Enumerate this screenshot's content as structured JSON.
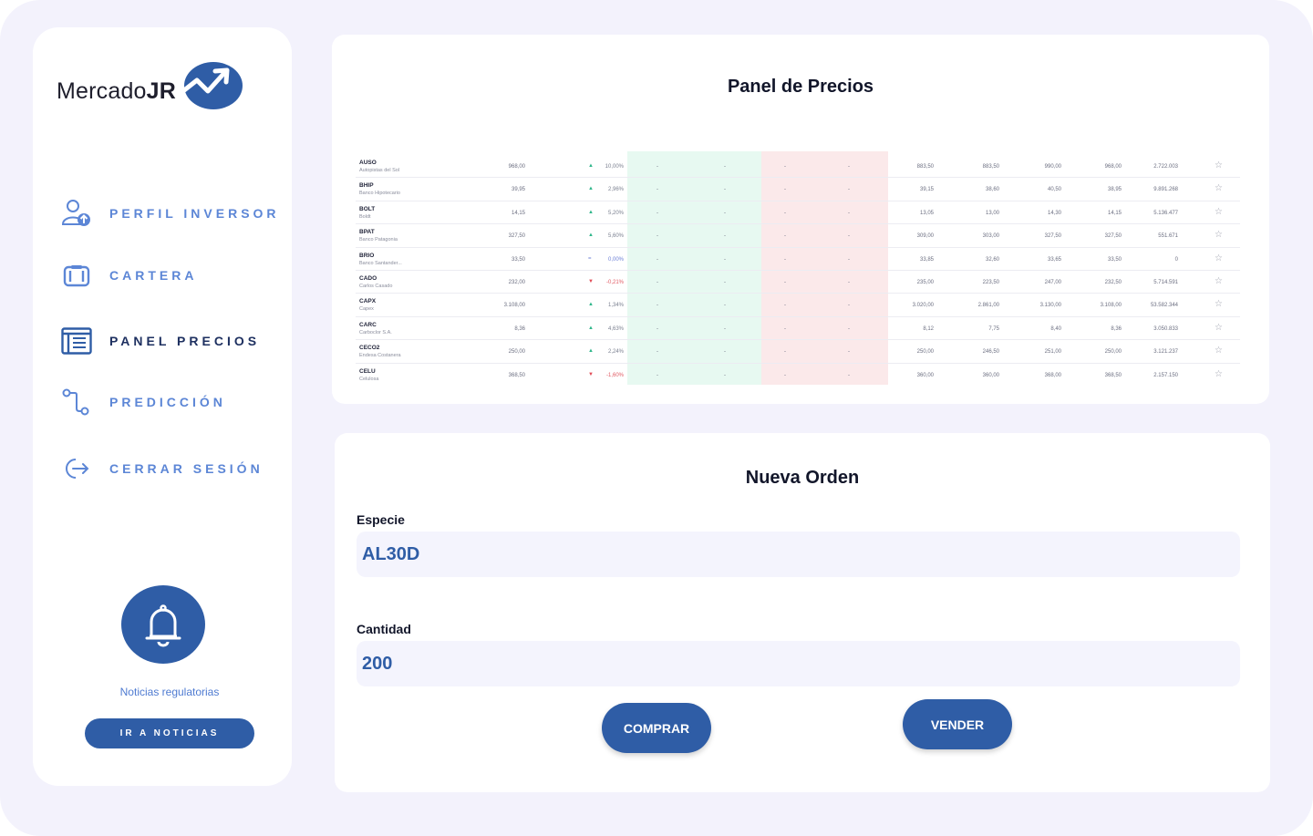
{
  "sidebar": {
    "logo": {
      "text_regular": "Mercado",
      "text_bold": "JR"
    },
    "nav": [
      {
        "label": "PERFIL INVERSOR",
        "icon": "user-upload-icon"
      },
      {
        "label": "CARTERA",
        "icon": "camera-icon"
      },
      {
        "label": "PANEL PRECIOS",
        "icon": "list-panel-icon"
      },
      {
        "label": "PREDICCIÓN",
        "icon": "path-nodes-icon"
      },
      {
        "label": "CERRAR SESIÓN",
        "icon": "logout-icon"
      }
    ],
    "active_nav": "PANEL PRECIOS",
    "news": {
      "label": "Noticias regulatorias",
      "button": "IR A NOTICIAS",
      "icon": "bell-icon"
    }
  },
  "prices_panel": {
    "title": "Panel de Precios",
    "rows": [
      {
        "symbol": "AUSO",
        "name": "Autopistas del Sol",
        "last": "968,00",
        "trend": "up",
        "pct": "10,00%",
        "c1": "883,50",
        "c2": "883,50",
        "c3": "990,00",
        "c4": "968,00",
        "volume": "2.722.003"
      },
      {
        "symbol": "BHIP",
        "name": "Banco Hipotecario",
        "last": "39,95",
        "trend": "up",
        "pct": "2,96%",
        "c1": "39,15",
        "c2": "38,60",
        "c3": "40,50",
        "c4": "38,95",
        "volume": "9.891.268"
      },
      {
        "symbol": "BOLT",
        "name": "Boldt",
        "last": "14,15",
        "trend": "up",
        "pct": "5,20%",
        "c1": "13,05",
        "c2": "13,00",
        "c3": "14,30",
        "c4": "14,15",
        "volume": "5.136.477"
      },
      {
        "symbol": "BPAT",
        "name": "Banco Patagonia",
        "last": "327,50",
        "trend": "up",
        "pct": "5,60%",
        "c1": "309,00",
        "c2": "303,00",
        "c3": "327,50",
        "c4": "327,50",
        "volume": "551.671"
      },
      {
        "symbol": "BRIO",
        "name": "Banco Santander...",
        "last": "33,50",
        "trend": "eq",
        "pct": "0,00%",
        "c1": "33,85",
        "c2": "32,60",
        "c3": "33,65",
        "c4": "33,50",
        "volume": "0"
      },
      {
        "symbol": "CADO",
        "name": "Carlos Casado",
        "last": "232,00",
        "trend": "down",
        "pct": "-0,21%",
        "c1": "235,00",
        "c2": "223,50",
        "c3": "247,00",
        "c4": "232,50",
        "volume": "5.714.591"
      },
      {
        "symbol": "CAPX",
        "name": "Capex",
        "last": "3.108,00",
        "trend": "up",
        "pct": "1,34%",
        "c1": "3.020,00",
        "c2": "2.861,00",
        "c3": "3.130,00",
        "c4": "3.108,00",
        "volume": "53.582.344"
      },
      {
        "symbol": "CARC",
        "name": "Carboclor S.A.",
        "last": "8,36",
        "trend": "up",
        "pct": "4,63%",
        "c1": "8,12",
        "c2": "7,75",
        "c3": "8,40",
        "c4": "8,36",
        "volume": "3.050.833"
      },
      {
        "symbol": "CECO2",
        "name": "Endesa Costanera",
        "last": "250,00",
        "trend": "up",
        "pct": "2,24%",
        "c1": "250,00",
        "c2": "246,50",
        "c3": "251,00",
        "c4": "250,00",
        "volume": "3.121.237"
      },
      {
        "symbol": "CELU",
        "name": "Celulosa",
        "last": "368,50",
        "trend": "down",
        "pct": "-1,60%",
        "c1": "360,00",
        "c2": "360,00",
        "c3": "368,00",
        "c4": "368,50",
        "volume": "2.157.150"
      }
    ],
    "dash": "-"
  },
  "order": {
    "title": "Nueva Orden",
    "species_label": "Especie",
    "species_value": "AL30D",
    "quantity_label": "Cantidad",
    "quantity_value": "200",
    "buy_label": "COMPRAR",
    "sell_label": "VENDER"
  },
  "colors": {
    "accent": "#2f5da6",
    "nav": "#5c86d6",
    "nav_active": "#1e3060",
    "background": "#f3f2fc",
    "up": "#2fb68a",
    "down": "#e14b56"
  }
}
